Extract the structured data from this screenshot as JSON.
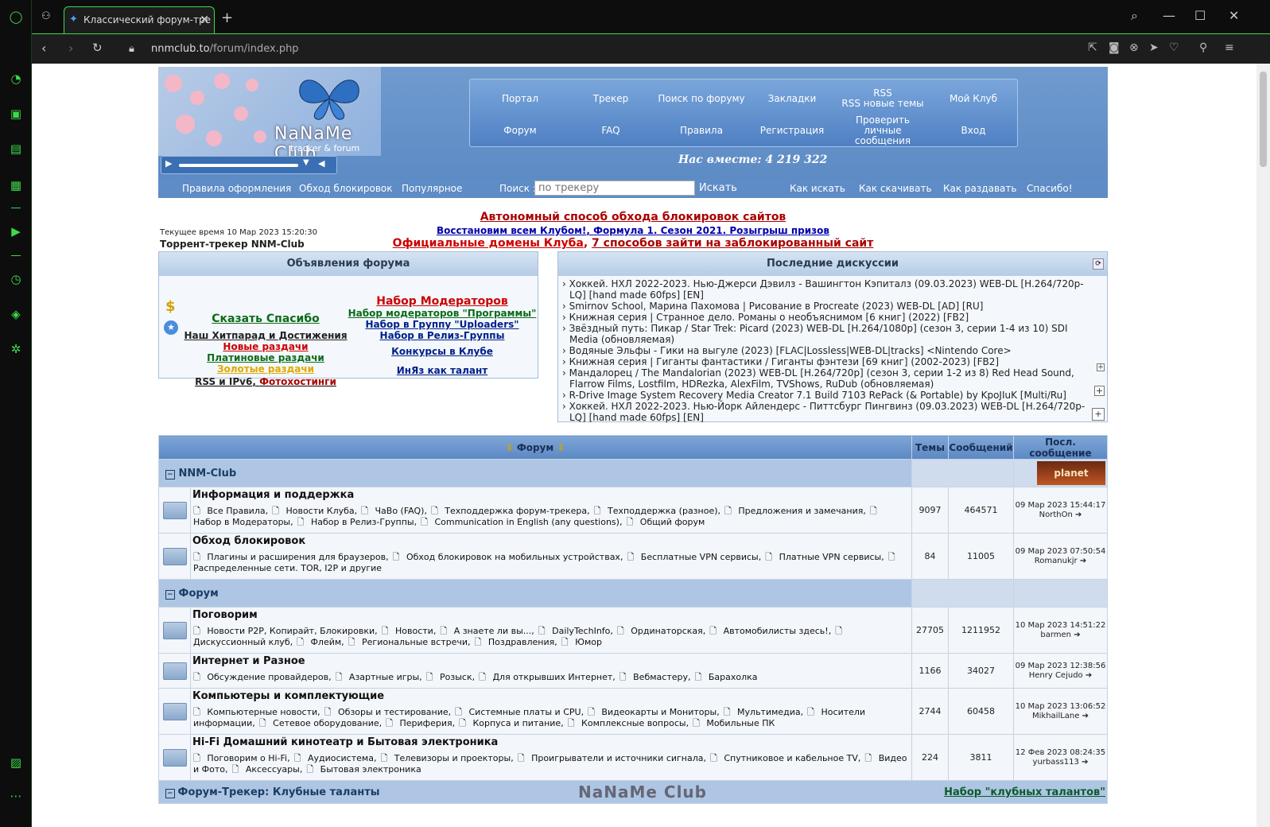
{
  "browser": {
    "tab_title": "Классический форум-тре",
    "url_host": "nnmclub.to",
    "url_path": "/forum/index.php"
  },
  "header": {
    "logo_text": "NaNaMe Club",
    "logo_sub": "tracker & forum",
    "menu": [
      {
        "label": "Портал"
      },
      {
        "label": "Трекер"
      },
      {
        "label": "Поиск по форуму"
      },
      {
        "label": "Закладки"
      },
      {
        "label": "RSS\nRSS новые темы"
      },
      {
        "label": "Мой Клуб"
      },
      {
        "label": "Форум"
      },
      {
        "label": "FAQ"
      },
      {
        "label": "Правила"
      },
      {
        "label": "Регистрация"
      },
      {
        "label": "Проверить личные сообщения"
      },
      {
        "label": "Вход"
      }
    ],
    "together": "Нас вместе: 4 219 322"
  },
  "subnav": {
    "left": [
      "Правила оформления",
      "Обход блокировок",
      "Популярное"
    ],
    "search_label": "Поиск :",
    "search_placeholder": "по трекеру",
    "search_btn": "Искать",
    "right": [
      "Как искать",
      "Как скачивать",
      "Как раздавать",
      "Спасибо!"
    ]
  },
  "info": {
    "current_time": "Текущее время 10 Мар 2023 15:20:30",
    "tracker_name": "Торрент-трекер NNM-Club",
    "line1": "Автономный способ обхода блокировок сайтов",
    "line2a": "Восстановим всем Клубом!",
    "line2b": "Формула 1. Сезон 2021. Розыгрыш призов",
    "line3a": "Официальные домены Клуба",
    "line3b": "7 способов зайти на заблокированный сайт"
  },
  "announce": {
    "title": "Объявления форума",
    "left": [
      {
        "text": "Сказать Спасибо",
        "color": "#0b6b1a"
      },
      {
        "text": "Наш Хитпарад и Достижения",
        "color": "#222"
      },
      {
        "text": "Новые раздачи",
        "color": "#c00"
      },
      {
        "text": "Платиновые раздачи",
        "color": "#0b6b1a"
      },
      {
        "text": "Золотые раздачи",
        "color": "#e0a800"
      },
      {
        "text": "RSS и IPv6",
        "color": "#222"
      },
      {
        "text": "Фотохостинги",
        "color": "#a00"
      }
    ],
    "right": [
      {
        "text": "Набор Модераторов",
        "color": "#c00"
      },
      {
        "text": "Набор модераторов \"Программы\"",
        "color": "#0b6b1a"
      },
      {
        "text": "Набор в Группу \"Uploaders\"",
        "color": "#00208a"
      },
      {
        "text": "Набор в Релиз-Группы",
        "color": "#00208a"
      },
      {
        "text": "Конкурсы в Клубе",
        "color": "#00208a"
      },
      {
        "text": "ИнЯз как талант",
        "color": "#00208a"
      }
    ]
  },
  "discussions": {
    "title": "Последние дискуссии",
    "items": [
      "Хоккей. НХЛ 2022-2023. Нью-Джерси Дэвилз - Вашингтон Кэпиталз (09.03.2023) WEB-DL [H.264/720p-LQ] [hand made 60fps] [EN]",
      "Smirnov School, Марина Пахомова | Рисование в Procreate (2023) WEB-DL [AD] [RU]",
      "Книжная серия | Странное дело. Романы о необъяснимом [6 книг] (2022) [FB2]",
      "Звёздный путь: Пикар / Star Trek: Picard (2023) WEB-DL [H.264/1080p] (сезон 3, серии 1-4 из 10) SDI Media (обновляемая)",
      "Водяные Эльфы - Гики на выгуле (2023) [FLAC|Lossless|WEB-DL|tracks] <Nintendo Core>",
      "Книжная серия | Гиганты фантастики / Гиганты фэнтези [69 книг] (2002-2023) [FB2]",
      "Мандалорец / The Mandalorian (2023) WEB-DL [H.264/720p] (сезон 3, серии 1-2 из 8) Red Head Sound, Flarrow Films, Lostfilm, HDRezka, AlexFilm, TVShows, RuDub (обновляемая)",
      "R-Drive Image System Recovery Media Creator 7.1 Build 7103 RePack (& Portable) by KpoJIuK [Multi/Ru]",
      "Хоккей. НХЛ 2022-2023. Нью-Йорк Айлендерс - Питтсбург Пингвинз (09.03.2023) WEB-DL [H.264/720p-LQ] [hand made 60fps] [EN]"
    ]
  },
  "table": {
    "col_forum": "Форум",
    "col_topics": "Темы",
    "col_posts": "Сообщений",
    "col_last": "Посл. сообщение",
    "planet_badge": "planet",
    "categories": [
      {
        "name": "NNM-Club",
        "forums": [
          {
            "name": "Информация и поддержка",
            "subs": [
              "Все Правила",
              "Новости Клуба",
              "ЧаВо (FAQ)",
              "Техподдержка форум-трекера",
              "Техподдержка (разное)",
              "Предложения и замечания",
              "Набор в Модераторы",
              "Набор в Релиз-Группы",
              "Communication in English (any questions)",
              "Общий форум"
            ],
            "topics": "9097",
            "posts": "464571",
            "last_date": "09 Мар 2023 15:44:17",
            "last_user": "NorthOn"
          },
          {
            "name": "Обход блокировок",
            "subs": [
              "Плагины и расширения для браузеров",
              "Обход блокировок на мобильных устройствах",
              "Бесплатные VPN сервисы",
              "Платные VPN сервисы",
              "Распределенные сети. TOR, I2P и другие"
            ],
            "topics": "84",
            "posts": "11005",
            "last_date": "09 Мар 2023 07:50:54",
            "last_user": "Romanukjr"
          }
        ]
      },
      {
        "name": "Форум",
        "forums": [
          {
            "name": "Поговорим",
            "subs": [
              "Новости P2P, Копирайт, Блокировки",
              "Новости",
              "А знаете ли вы...",
              "DailyTechInfo",
              "Ординаторская",
              "Автомобилисты здесь!",
              "Дискуссионный клуб",
              "Флейм",
              "Региональные встречи",
              "Поздравления",
              "Юмор"
            ],
            "topics": "27705",
            "posts": "1211952",
            "last_date": "10 Мар 2023 14:51:22",
            "last_user": "barmen"
          },
          {
            "name": "Интернет и Разное",
            "subs": [
              "Обсуждение провайдеров",
              "Азартные игры",
              "Розыск",
              "Для открывших Интернет",
              "Вебмастеру",
              "Барахолка"
            ],
            "topics": "1166",
            "posts": "34027",
            "last_date": "09 Мар 2023 12:38:56",
            "last_user": "Henry Cejudo"
          },
          {
            "name": "Компьютеры и комплектующие",
            "subs": [
              "Компьютерные новости",
              "Обзоры и тестирование",
              "Системные платы и CPU",
              "Видеокарты и Мониторы",
              "Мультимедиа",
              "Носители информации",
              "Сетевое оборудование",
              "Периферия",
              "Корпуса и питание",
              "Комплексные вопросы",
              "Мобильные ПК"
            ],
            "topics": "2744",
            "posts": "60458",
            "last_date": "10 Мар 2023 13:06:52",
            "last_user": "MikhailLane"
          },
          {
            "name": "Hi-Fi Домашний кинотеатр и Бытовая электроника",
            "subs": [
              "Поговорим о Hi-Fi",
              "Аудиосистема",
              "Телевизоры и проекторы",
              "Проигрыватели и источники сигнала",
              "Спутниковое и кабельное TV",
              "Видео и Фото",
              "Аксессуары",
              "Бытовая электроника"
            ],
            "topics": "224",
            "posts": "3811",
            "last_date": "12 Фев 2023 08:24:35",
            "last_user": "yurbass113"
          }
        ]
      }
    ],
    "last_cat": "Форум-Трекер: Клубные таланты",
    "last_cat_link": "Набор \"клубных талантов\""
  }
}
